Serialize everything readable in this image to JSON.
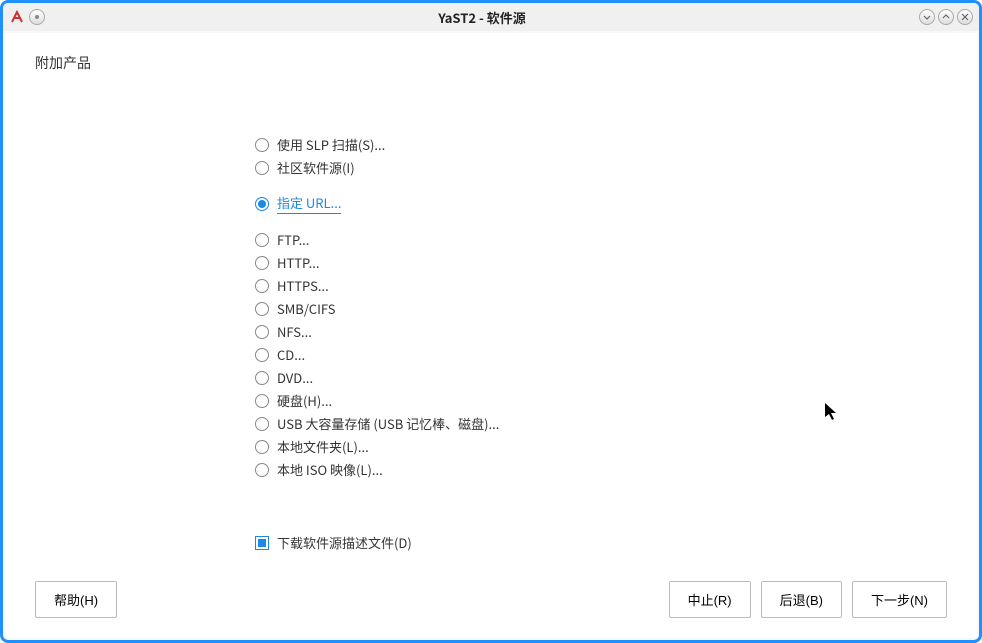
{
  "window": {
    "title": "YaST2  -  软件源"
  },
  "heading": "附加产品",
  "radio_groups": [
    {
      "items": [
        {
          "label": "使用 SLP 扫描(S)...",
          "checked": false
        },
        {
          "label": "社区软件源(I)",
          "checked": false
        }
      ]
    },
    {
      "items": [
        {
          "label": "指定 URL...",
          "checked": true
        }
      ]
    },
    {
      "items": [
        {
          "label": "FTP...",
          "checked": false
        },
        {
          "label": "HTTP...",
          "checked": false
        },
        {
          "label": "HTTPS...",
          "checked": false
        },
        {
          "label": "SMB/CIFS",
          "checked": false
        },
        {
          "label": "NFS...",
          "checked": false
        },
        {
          "label": "CD...",
          "checked": false
        },
        {
          "label": "DVD...",
          "checked": false
        },
        {
          "label": "硬盘(H)...",
          "checked": false
        },
        {
          "label": "USB 大容量存储 (USB 记忆棒、磁盘)...",
          "checked": false
        },
        {
          "label": "本地文件夹(L)...",
          "checked": false
        },
        {
          "label": "本地 ISO 映像(L)...",
          "checked": false
        }
      ]
    }
  ],
  "checkbox": {
    "label": "下载软件源描述文件(D)",
    "checked": true
  },
  "buttons": {
    "help": "帮助(H)",
    "abort": "中止(R)",
    "back": "后退(B)",
    "next": "下一步(N)"
  }
}
